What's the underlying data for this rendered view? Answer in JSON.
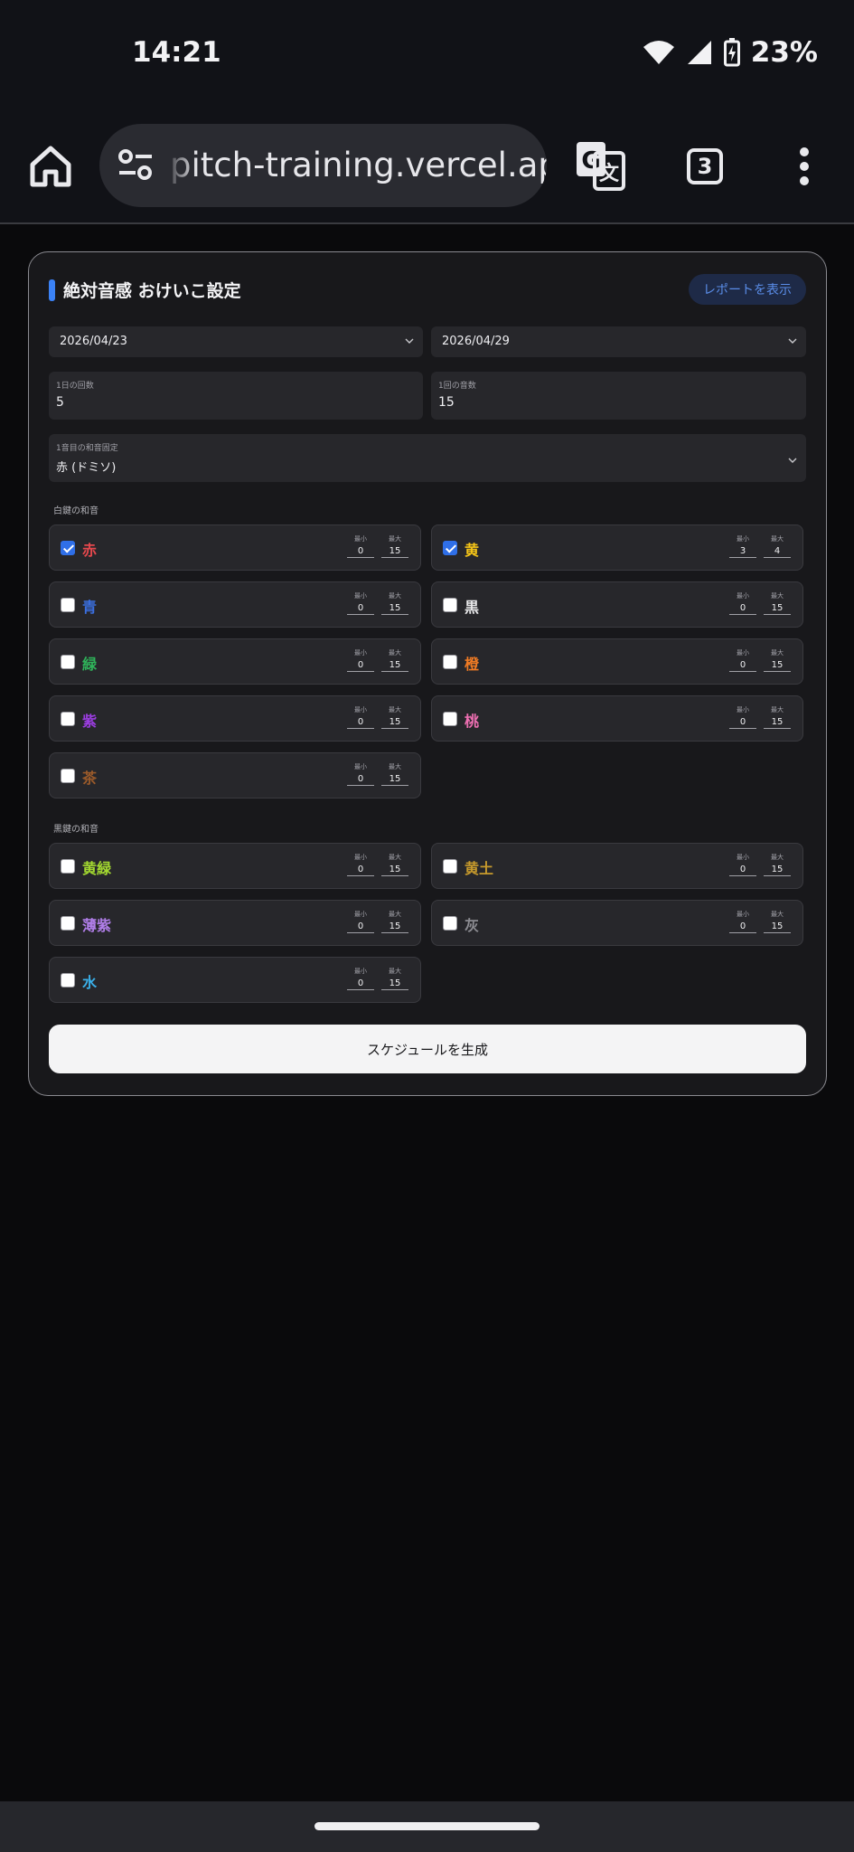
{
  "status": {
    "time": "14:21",
    "battery": "23%"
  },
  "browser": {
    "url": "pitch-training.vercel.app",
    "tab_count": "3"
  },
  "card": {
    "title": "絶対音感 おけいこ設定",
    "report_button": "レポートを表示",
    "start_date": "2026/04/23",
    "end_date": "2026/04/29",
    "daily_count": {
      "label": "1日の回数",
      "value": "5"
    },
    "notes_per_session": {
      "label": "1回の音数",
      "value": "15"
    },
    "first_chord_fixed": {
      "label": "1音目の和音固定",
      "value": "赤 (ドミソ)"
    },
    "white_section_title": "白鍵の和音",
    "black_section_title": "黒鍵の和音",
    "min_label": "最小",
    "max_label": "最大",
    "white_chords": [
      {
        "name": "赤",
        "color": "#e5484d",
        "checked": true,
        "min": "0",
        "max": "15"
      },
      {
        "name": "黄",
        "color": "#f5c518",
        "checked": true,
        "min": "3",
        "max": "4"
      },
      {
        "name": "青",
        "color": "#3b6fe0",
        "checked": false,
        "min": "0",
        "max": "15"
      },
      {
        "name": "黒",
        "color": "#e8e8ea",
        "checked": false,
        "min": "0",
        "max": "15"
      },
      {
        "name": "緑",
        "color": "#2fb35a",
        "checked": false,
        "min": "0",
        "max": "15"
      },
      {
        "name": "橙",
        "color": "#f07b24",
        "checked": false,
        "min": "0",
        "max": "15"
      },
      {
        "name": "紫",
        "color": "#9b3de0",
        "checked": false,
        "min": "0",
        "max": "15"
      },
      {
        "name": "桃",
        "color": "#ee6fb2",
        "checked": false,
        "min": "0",
        "max": "15"
      },
      {
        "name": "茶",
        "color": "#9a5a2a",
        "checked": false,
        "min": "0",
        "max": "15"
      }
    ],
    "black_chords": [
      {
        "name": "黄緑",
        "color": "#a3d930",
        "checked": false,
        "min": "0",
        "max": "15"
      },
      {
        "name": "黄土",
        "color": "#c79a2c",
        "checked": false,
        "min": "0",
        "max": "15"
      },
      {
        "name": "薄紫",
        "color": "#b07ee8",
        "checked": false,
        "min": "0",
        "max": "15"
      },
      {
        "name": "灰",
        "color": "#8c8c92",
        "checked": false,
        "min": "0",
        "max": "15"
      },
      {
        "name": "水",
        "color": "#3ab0ea",
        "checked": false,
        "min": "0",
        "max": "15"
      }
    ],
    "generate_button": "スケジュールを生成"
  }
}
